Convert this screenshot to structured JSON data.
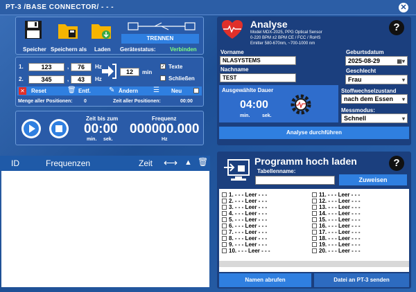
{
  "window": {
    "title": "PT-3   /BASE CONNECTOR/   - - -"
  },
  "toolbar": {
    "save_label": "Speicher",
    "save_as_label": "Speichern als",
    "load_label": "Laden",
    "device_status_label": "Gerätestatus:",
    "disconnect_label": "TRENNEN",
    "connect_label": "Verbinden"
  },
  "freq": {
    "row1_prefix": "1.",
    "row1_a": "123",
    "row1_b": "76",
    "row1_unit": "Hz",
    "row2_prefix": "2.",
    "row2_a": "345",
    "row2_b": "43",
    "row2_unit": "Hz",
    "minutes": "12",
    "minutes_unit": "min",
    "texte_label": "Texte",
    "schliessen_label": "Schließen",
    "reset_label": "Reset",
    "entf_label": "Entf.",
    "aendern_label": "Ändern",
    "neu_label": "Neu",
    "menge_label": "Menge aller Positionen:",
    "menge_value": "0",
    "zeit_label": "Zeit aller Positionen:",
    "zeit_value": "00:00"
  },
  "player": {
    "time_label": "Zeit bis zum",
    "time_value": "00:00",
    "time_min": "min.",
    "time_sek": "sek.",
    "freq_label": "Frequenz",
    "freq_value": "000000.000",
    "freq_unit": "Hz"
  },
  "table": {
    "col_id": "ID",
    "col_freq": "Frequenzen",
    "col_time": "Zeit"
  },
  "analyse": {
    "title": "Analyse",
    "model": "Model  MDX-2025, PPG Optical Sensor",
    "range": "0-220 BPM ±2 BPM     CE / FCC / RoHS",
    "emitter": "Emitter 580-670nm,   ~700-1000 nm",
    "vorname_label": "Vorname",
    "vorname_value": "NLASYSTEMS",
    "nachname_label": "Nachname",
    "nachname_value": "TEST",
    "dauer_label": "Ausgewählte Dauer",
    "dauer_value": "04:00",
    "dauer_min": "min.",
    "dauer_sek": "sek.",
    "geburt_label": "Geburtsdatum",
    "geburt_value": "2025-08-29",
    "geschlecht_label": "Geschlecht",
    "geschlecht_value": "Frau",
    "stoff_label": "Stoffwechselzustand",
    "stoff_value": "nach dem Essen",
    "mess_label": "Messmodus:",
    "mess_value": "Schnell",
    "run_label": "Analyse durchführen"
  },
  "programm": {
    "title": "Programm hoch laden",
    "tabellen_label": "Tabellenname:",
    "assign_label": "Zuweisen",
    "left_items": [
      "1. - - - Leer - - -",
      "2. - - - Leer - - -",
      "3. - - - Leer - - -",
      "4. - - - Leer - - -",
      "5. - - - Leer - - -",
      "6. - - - Leer - - -",
      "7. - - - Leer - - -",
      "8. - - - Leer - - -",
      "9. - - - Leer - - -",
      "10. - - - Leer - - -"
    ],
    "right_items": [
      "11. - - - Leer - - -",
      "12. - - - Leer - - -",
      "13. - - - Leer - - -",
      "14. - - - Leer - - -",
      "15. - - - Leer - - -",
      "16. - - - Leer - - -",
      "17. - - - Leer - - -",
      "18. - - - Leer - - -",
      "19. - - - Leer - - -",
      "20. - - - Leer - - -"
    ],
    "names_label": "Namen abrufen",
    "send_label": "Datei an PT-3 senden"
  },
  "colors": {
    "accent": "#2f7fe0",
    "panel": "#2a5ba8",
    "dark": "#1b3f7e",
    "red": "#e0302a"
  }
}
